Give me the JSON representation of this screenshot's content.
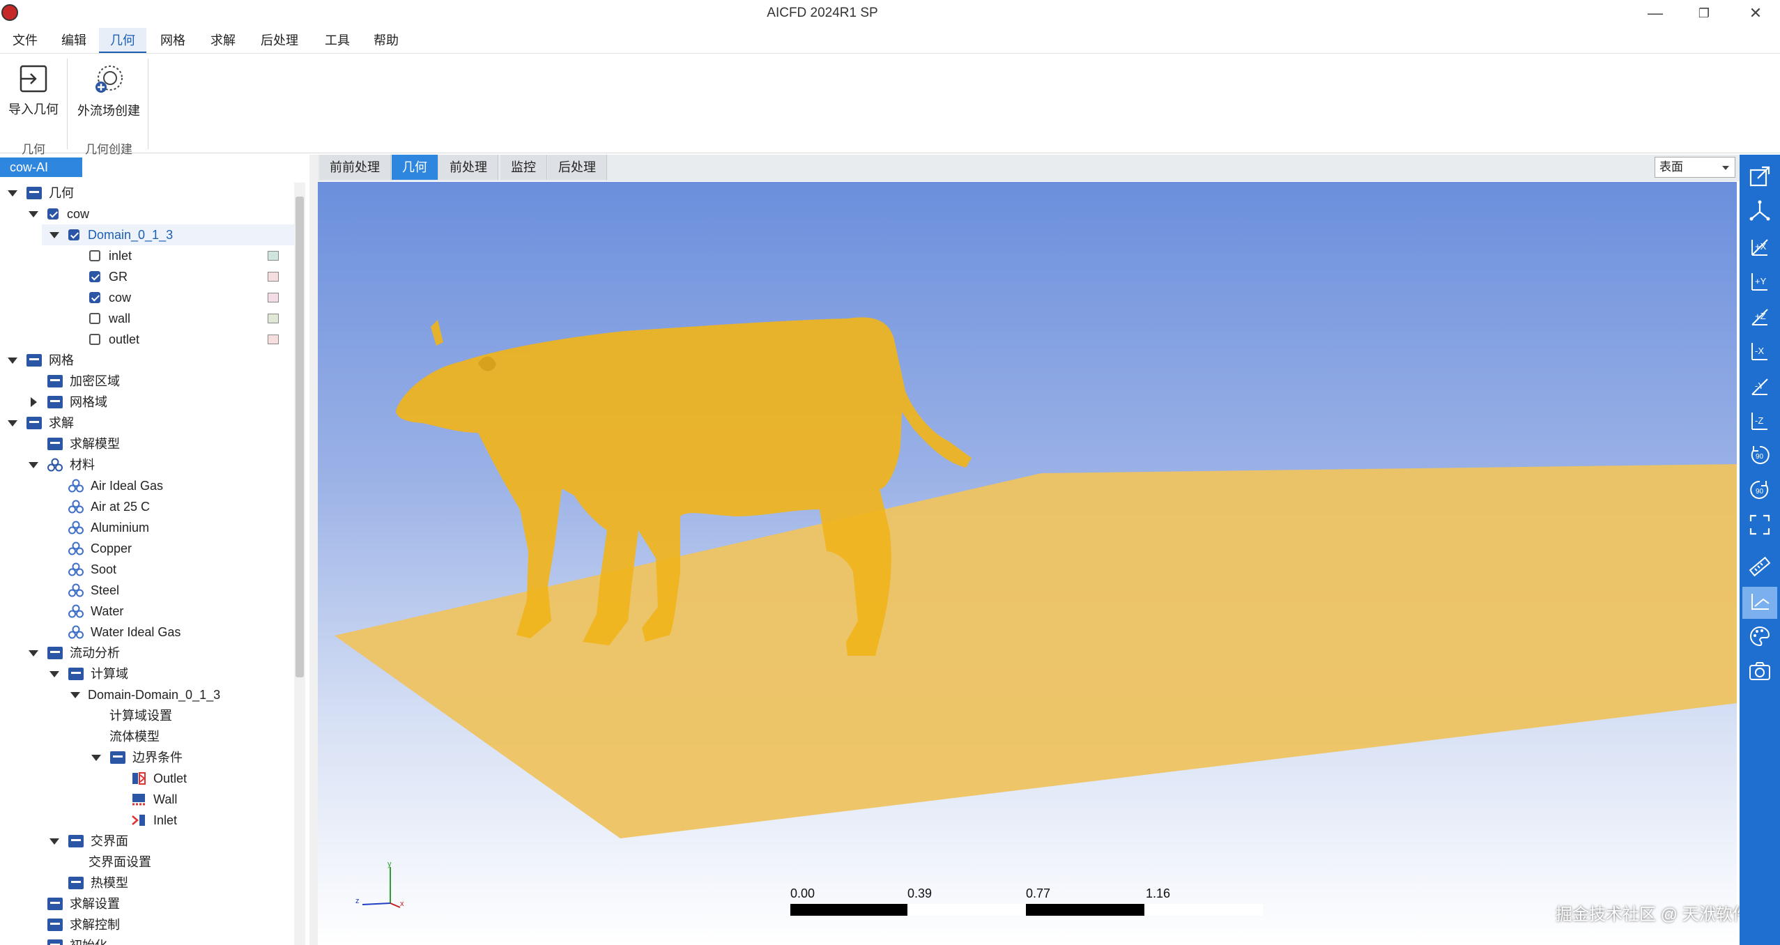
{
  "window": {
    "title": "AICFD 2024R1 SP",
    "minimize": "—",
    "restore": "❐",
    "close": "✕"
  },
  "menu": [
    "文件",
    "编辑",
    "几何",
    "网格",
    "求解",
    "后处理",
    "工具",
    "帮助"
  ],
  "ribbon": {
    "import_geometry": "导入几何",
    "external_flow": "外流场创建",
    "group_geometry": "几何",
    "group_create": "几何创建"
  },
  "tree_tab": "cow-AI",
  "tree": {
    "geometry": "几何",
    "cow": "cow",
    "domain": "Domain_0_1_3",
    "inlet": "inlet",
    "gr": "GR",
    "cow_surface": "cow",
    "wall": "wall",
    "outlet": "outlet",
    "mesh": "网格",
    "refine": "加密区域",
    "mesh_domain": "网格域",
    "solve": "求解",
    "solve_model": "求解模型",
    "materials": "材料",
    "mat_items": [
      "Air Ideal Gas",
      "Air at 25 C",
      "Aluminium",
      "Copper",
      "Soot",
      "Steel",
      "Water",
      "Water Ideal Gas"
    ],
    "flow_analysis": "流动分析",
    "calc_domain": "计算域",
    "domain_node": "Domain-Domain_0_1_3",
    "calc_domain_settings": "计算域设置",
    "fluid_model": "流体模型",
    "boundary": "边界条件",
    "bc_outlet": "Outlet",
    "bc_wall": "Wall",
    "bc_inlet": "Inlet",
    "interface": "交界面",
    "interface_settings": "交界面设置",
    "thermal_model": "热模型",
    "solve_settings": "求解设置",
    "solve_control": "求解控制",
    "init": "初始化"
  },
  "view_tabs": [
    "前前处理",
    "几何",
    "前处理",
    "监控",
    "后处理"
  ],
  "view_select": "表面",
  "scale": [
    "0.00",
    "0.39",
    "0.77",
    "1.16"
  ],
  "axes": {
    "x": "x",
    "y": "y",
    "z": "z"
  },
  "watermark": "掘金技术社区 @ 天洑软件",
  "colors": {
    "accent": "#2e86de",
    "model": "#f0b41c",
    "ground": "#eec361"
  }
}
